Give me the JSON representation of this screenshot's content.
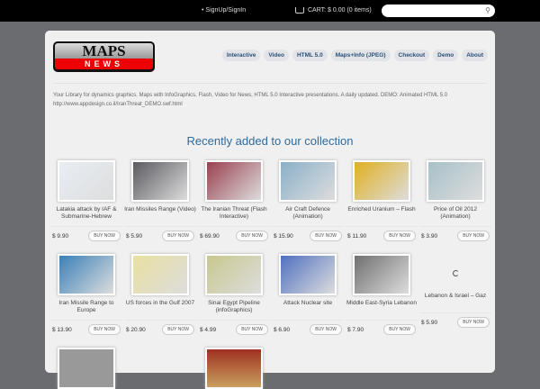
{
  "topbar": {
    "signin": "• SignUp/SignIn",
    "cart": "CART: $ 0.00 (0 items)",
    "search_placeholder": ""
  },
  "logo": {
    "line1": "MAPS",
    "line2": "NEWS"
  },
  "nav": [
    "Interactive",
    "Video",
    "HTML 5.0",
    "Maps+Info (JPEG)",
    "Checkout",
    "Demo",
    "About"
  ],
  "description": "Your Library for dynamics graphics. Maps with InfoGraphics, Flash, Video for News, HTML 5.0 Interactive presentations. A daily updated. DEMO: Animated HTML 5.0 http://www.appdesign.co.il/IranThreat_DEMO.swf.html",
  "heading": "Recently added to our collection",
  "buy_label": "BUY NOW",
  "products": [
    {
      "title": "Latakia attack by IAF & Submarine-Hebrew",
      "price": "$ 9.90",
      "color": "#e8eef4"
    },
    {
      "title": "Iran Missiles Range (Video)",
      "price": "$ 5.90",
      "color": "#5a5a60"
    },
    {
      "title": "The Iranian Threat (Flash Interactive)",
      "price": "$ 69.90",
      "color": "#9a4050"
    },
    {
      "title": "Air Craft Defence (Animation)",
      "price": "$ 15.90",
      "color": "#8ab0c8"
    },
    {
      "title": "Enriched Uranium – Flash",
      "price": "$ 11.90",
      "color": "#e0b020"
    },
    {
      "title": "Price of Oil 2012 (Animation)",
      "price": "$ 3.90",
      "color": "#a8c0c8"
    },
    {
      "title": "Iran Missile Range to Europe",
      "price": "$ 13.90",
      "color": "#3a80b8"
    },
    {
      "title": "US forces in the Gulf 2007",
      "price": "$ 20.90",
      "color": "#e8e0a0"
    },
    {
      "title": "Sinai Egypt Pipeline (infoGraphics)",
      "price": "$ 4.99",
      "color": "#c8c890"
    },
    {
      "title": "Attack Nuclear site",
      "price": "$ 6.90",
      "color": "#5070c0"
    },
    {
      "title": "Middle East-Syria Lebanon",
      "price": "$ 7.90",
      "color": "#707070"
    },
    {
      "title": "Lebanon & Israel – Gaz",
      "price": "$ 5.90",
      "color": "loading"
    }
  ]
}
